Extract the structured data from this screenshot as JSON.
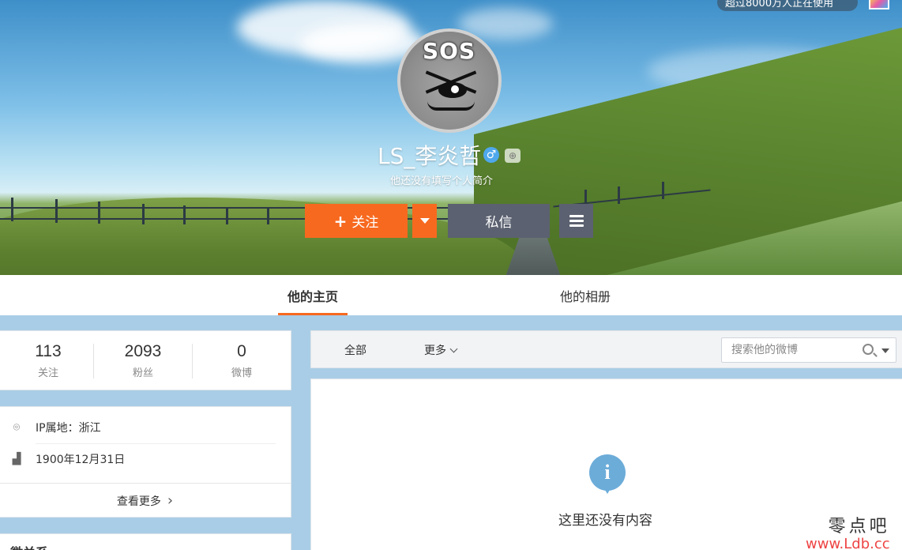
{
  "banner": {
    "top_pill_text": "超过8000万人正在使用",
    "avatar_text": "SOS"
  },
  "profile": {
    "name": "LS_李炎哲",
    "gender_icon": "male-icon",
    "gender_symbol": "♂",
    "bio": "他还没有填写个人简介",
    "colors": {
      "follow": "#f7691f",
      "message": "#5b6170",
      "gender": "#4fa8ec"
    }
  },
  "actions": {
    "follow_label": "关注",
    "follow_plus": "+",
    "message_label": "私信"
  },
  "tabs": [
    {
      "label": "他的主页",
      "active": true
    },
    {
      "label": "他的相册",
      "active": false
    }
  ],
  "stats": [
    {
      "value": "113",
      "label": "关注"
    },
    {
      "value": "2093",
      "label": "粉丝"
    },
    {
      "value": "0",
      "label": "微博"
    }
  ],
  "info": {
    "ip_label": "IP属地：浙江",
    "birthday": "1900年12月31日",
    "more_label": "查看更多",
    "more_chevron": "›"
  },
  "relation": {
    "title": "微关系"
  },
  "filter": {
    "all_label": "全部",
    "more_label": "更多",
    "search_placeholder": "搜索他的微博"
  },
  "content": {
    "empty_icon": "i",
    "empty_text": "这里还没有内容"
  },
  "watermark": {
    "cn": "零点吧",
    "url": "www.Ldb.cc"
  }
}
